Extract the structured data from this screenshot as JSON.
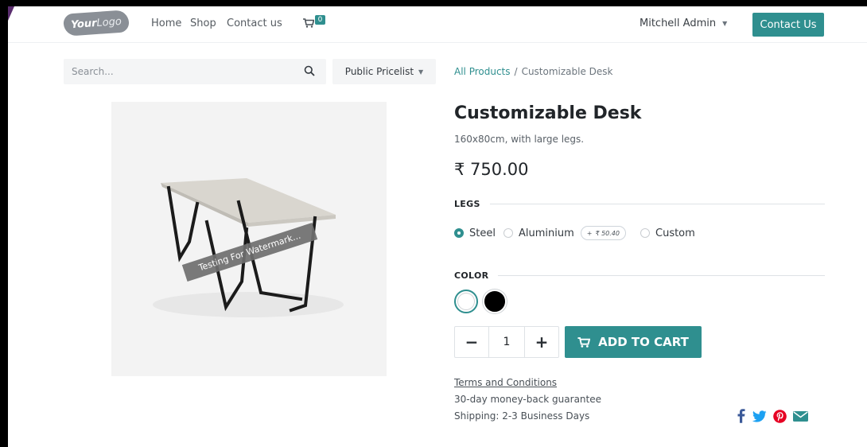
{
  "header": {
    "logo": {
      "part1": "Your",
      "part2": "Logo"
    },
    "nav": [
      {
        "label": "Home"
      },
      {
        "label": "Shop"
      },
      {
        "label": "Contact us"
      }
    ],
    "cart_count": "0",
    "user_name": "Mitchell Admin",
    "contact_button": "Contact Us"
  },
  "search": {
    "placeholder": "Search..."
  },
  "pricelist": {
    "label": "Public Pricelist"
  },
  "breadcrumb": {
    "parent": "All Products",
    "separator": "/",
    "current": "Customizable Desk"
  },
  "image": {
    "watermark": "Testing For Watermark..."
  },
  "product": {
    "name": "Customizable Desk",
    "description": "160x80cm, with large legs.",
    "price": "₹ 750.00"
  },
  "attributes": {
    "legs": {
      "label": "LEGS",
      "options": [
        {
          "label": "Steel",
          "checked": true
        },
        {
          "label": "Aluminium",
          "extra": "₹ 50.40"
        },
        {
          "label": "Custom"
        }
      ]
    },
    "color": {
      "label": "COLOR",
      "swatches": [
        {
          "name": "White",
          "hex": "#ffffff",
          "selected": true
        },
        {
          "name": "Black",
          "hex": "#000000"
        }
      ]
    }
  },
  "quantity": {
    "value": "1",
    "minus": "−",
    "plus": "+"
  },
  "add_to_cart": "ADD TO CART",
  "info": {
    "terms": "Terms and Conditions",
    "guarantee": "30-day money-back guarantee",
    "shipping": "Shipping: 2-3 Business Days"
  },
  "colors": {
    "accent": "#2f8f8f",
    "facebook": "#3b5998",
    "twitter": "#1da1f2",
    "pinterest": "#e60023",
    "envelope": "#2f8f8f"
  },
  "share_icons": [
    "facebook-icon",
    "twitter-icon",
    "pinterest-icon",
    "envelope-icon"
  ]
}
